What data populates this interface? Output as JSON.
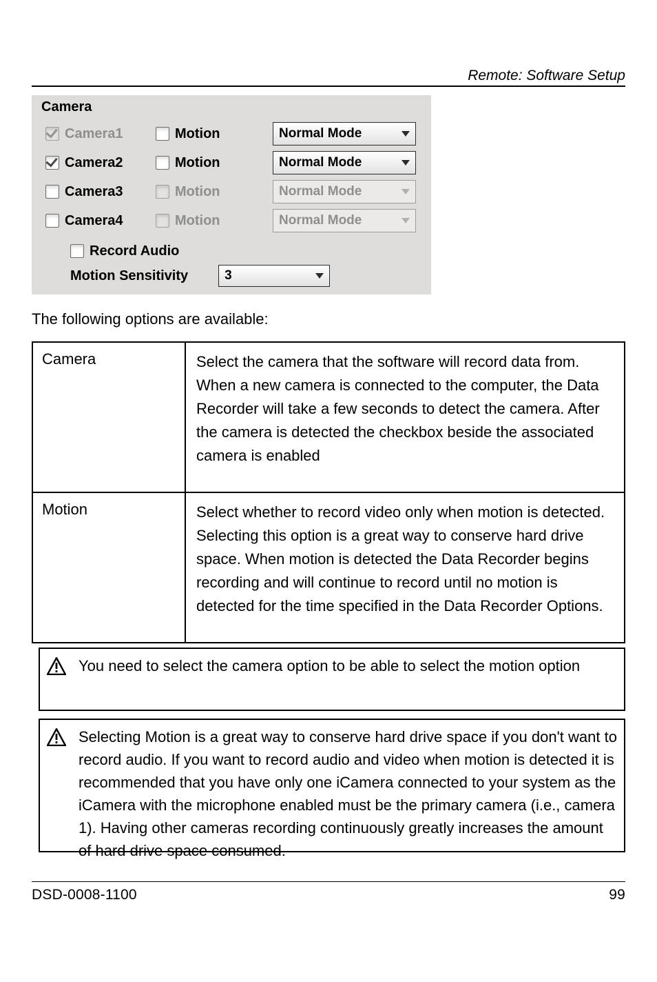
{
  "header": {
    "chapter_title": "Remote: Software Setup"
  },
  "panel": {
    "title": "Camera",
    "rows": [
      {
        "cam_checked": true,
        "cam_disabled": true,
        "cam_label": "Camera1",
        "motion_checked": false,
        "motion_disabled": false,
        "motion_label": "Motion",
        "mode_value": "Normal Mode",
        "mode_disabled": false
      },
      {
        "cam_checked": true,
        "cam_disabled": false,
        "cam_label": "Camera2",
        "motion_checked": false,
        "motion_disabled": false,
        "motion_label": "Motion",
        "mode_value": "Normal Mode",
        "mode_disabled": false
      },
      {
        "cam_checked": false,
        "cam_disabled": false,
        "cam_label": "Camera3",
        "motion_checked": false,
        "motion_disabled": true,
        "motion_label": "Motion",
        "mode_value": "Normal Mode",
        "mode_disabled": true
      },
      {
        "cam_checked": false,
        "cam_disabled": false,
        "cam_label": "Camera4",
        "motion_checked": false,
        "motion_disabled": true,
        "motion_label": "Motion",
        "mode_value": "Normal Mode",
        "mode_disabled": true
      }
    ],
    "record_audio_label": "Record Audio",
    "record_audio_checked": false,
    "sensitivity_label": "Motion Sensitivity",
    "sensitivity_value": "3"
  },
  "options_intro": "The following options are available:",
  "options": [
    {
      "name": "Camera",
      "desc": "Select the camera that the software will record data from. When a new camera is connected to the computer, the Data Recorder will take a few seconds to detect the camera. After the camera is detected the checkbox beside the associated camera is enabled"
    },
    {
      "name": "Motion",
      "desc": "Select whether to record video only when motion is detected. Selecting this option is a great way to conserve hard drive space. When motion is detected the Data Recorder begins recording and will continue to record until no motion is detected for the time specified in the Data Recorder Options."
    }
  ],
  "notices": [
    "You need to select the camera option to be able to select the motion option",
    "Selecting Motion is a great way to conserve hard drive space if you don't want to record audio. If you want to record audio and video when motion is detected it is recommended that you have only one iCamera connected to your system as the iCamera with the microphone enabled must be the primary camera (i.e., camera 1). Having other cameras recording continuously greatly increases the amount of hard drive space consumed."
  ],
  "footer": {
    "doc_id": "DSD-0008-1100",
    "page": "99"
  }
}
